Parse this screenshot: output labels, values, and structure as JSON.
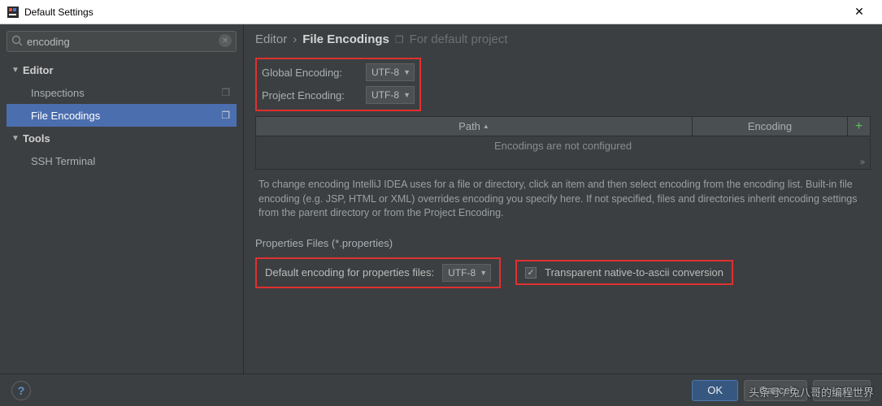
{
  "window": {
    "title": "Default Settings"
  },
  "search": {
    "value": "encoding",
    "placeholder": ""
  },
  "sidebar": {
    "groups": [
      {
        "chev": "▼",
        "label": "Editor"
      },
      {
        "chev": "▼",
        "label": "Tools"
      }
    ],
    "items": [
      {
        "label": "Inspections"
      },
      {
        "label": "File Encodings"
      },
      {
        "label": "SSH Terminal"
      }
    ]
  },
  "breadcrumb": {
    "parent": "Editor",
    "sep": "›",
    "current": "File Encodings",
    "project": "For default project"
  },
  "encoding": {
    "global_label": "Global Encoding:",
    "global_value": "UTF-8",
    "project_label": "Project Encoding:",
    "project_value": "UTF-8"
  },
  "table": {
    "path_header": "Path",
    "encoding_header": "Encoding",
    "empty_text": "Encodings are not configured"
  },
  "description": "To change encoding IntelliJ IDEA uses for a file or directory, click an item and then select encoding from the encoding list. Built-in file encoding (e.g. JSP, HTML or XML) overrides encoding you specify here. If not specified, files and directories inherit encoding settings from the parent directory or from the Project Encoding.",
  "properties": {
    "section": "Properties Files (*.properties)",
    "default_label": "Default encoding for properties files:",
    "default_value": "UTF-8",
    "checkbox_label": "Transparent native-to-ascii conversion",
    "checkbox_checked": true
  },
  "footer": {
    "help": "?",
    "ok": "OK",
    "cancel": "Cancel",
    "apply": "Apply"
  },
  "watermark": "头条号 / 兔八哥的编程世界"
}
